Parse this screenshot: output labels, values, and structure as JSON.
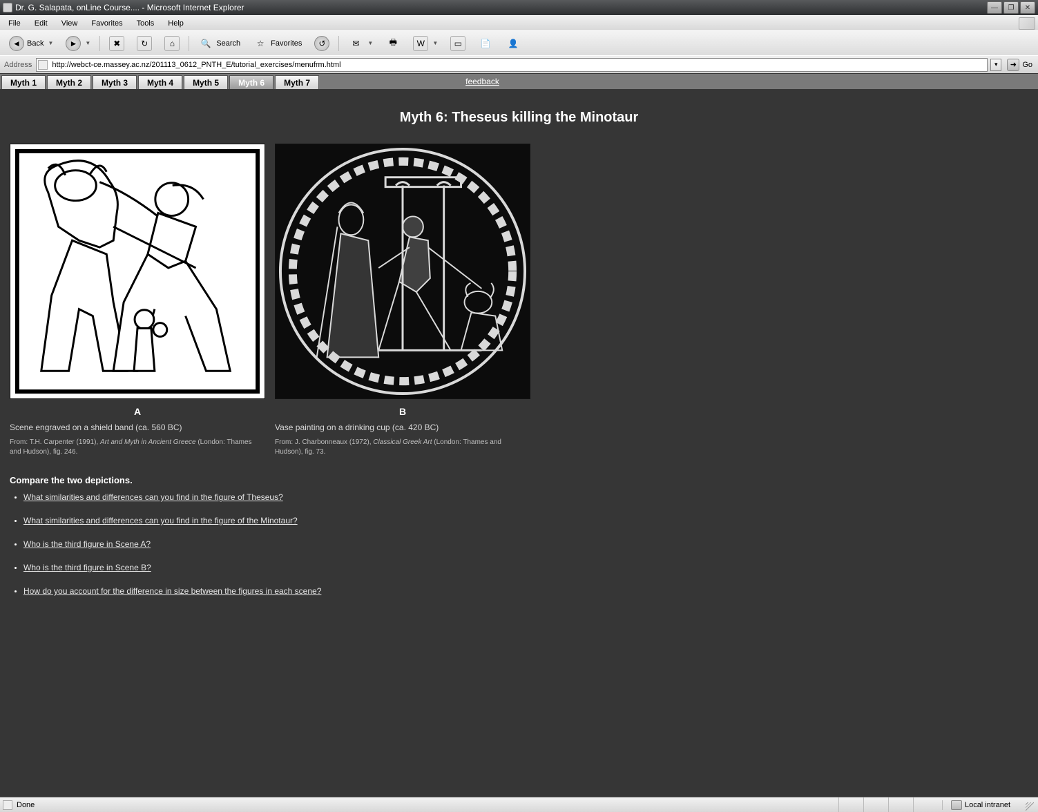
{
  "window": {
    "title": "Dr. G. Salapata, onLine Course.... - Microsoft Internet Explorer"
  },
  "menubar": [
    "File",
    "Edit",
    "View",
    "Favorites",
    "Tools",
    "Help"
  ],
  "toolbar": {
    "back": "Back",
    "search": "Search",
    "favorites": "Favorites"
  },
  "addressbar": {
    "label": "Address",
    "url": "http://webct-ce.massey.ac.nz/201113_0612_PNTH_E/tutorial_exercises/menufrm.html",
    "go": "Go"
  },
  "tabs": [
    "Myth 1",
    "Myth 2",
    "Myth 3",
    "Myth 4",
    "Myth 5",
    "Myth 6",
    "Myth 7"
  ],
  "active_tab_index": 5,
  "feedback_label": "feedback",
  "content": {
    "heading": "Myth 6: Theseus killing the Minotaur",
    "figA": {
      "letter": "A",
      "caption": "Scene engraved on a shield band (ca. 560 BC)",
      "source_pre": "From: T.H. Carpenter (1991), ",
      "source_ital": "Art and Myth in Ancient Greece",
      "source_post": " (London: Thames and Hudson), fig. 246."
    },
    "figB": {
      "letter": "B",
      "caption": "Vase painting on a drinking cup (ca. 420 BC)",
      "source_pre": "From: J. Charbonneaux (1972), ",
      "source_ital": "Classical Greek Art",
      "source_post": " (London: Thames and Hudson), fig. 73."
    },
    "compare": "Compare the two depictions.",
    "questions": [
      "What similarities and differences can you find in the figure of Theseus?",
      "What similarities and differences can you find in the figure of the Minotaur?",
      "Who is the third figure in Scene A?",
      "Who is the third figure in Scene B?",
      "How do you account for the difference in size between the figures in each scene?"
    ]
  },
  "statusbar": {
    "status": "Done",
    "zone": "Local intranet"
  }
}
